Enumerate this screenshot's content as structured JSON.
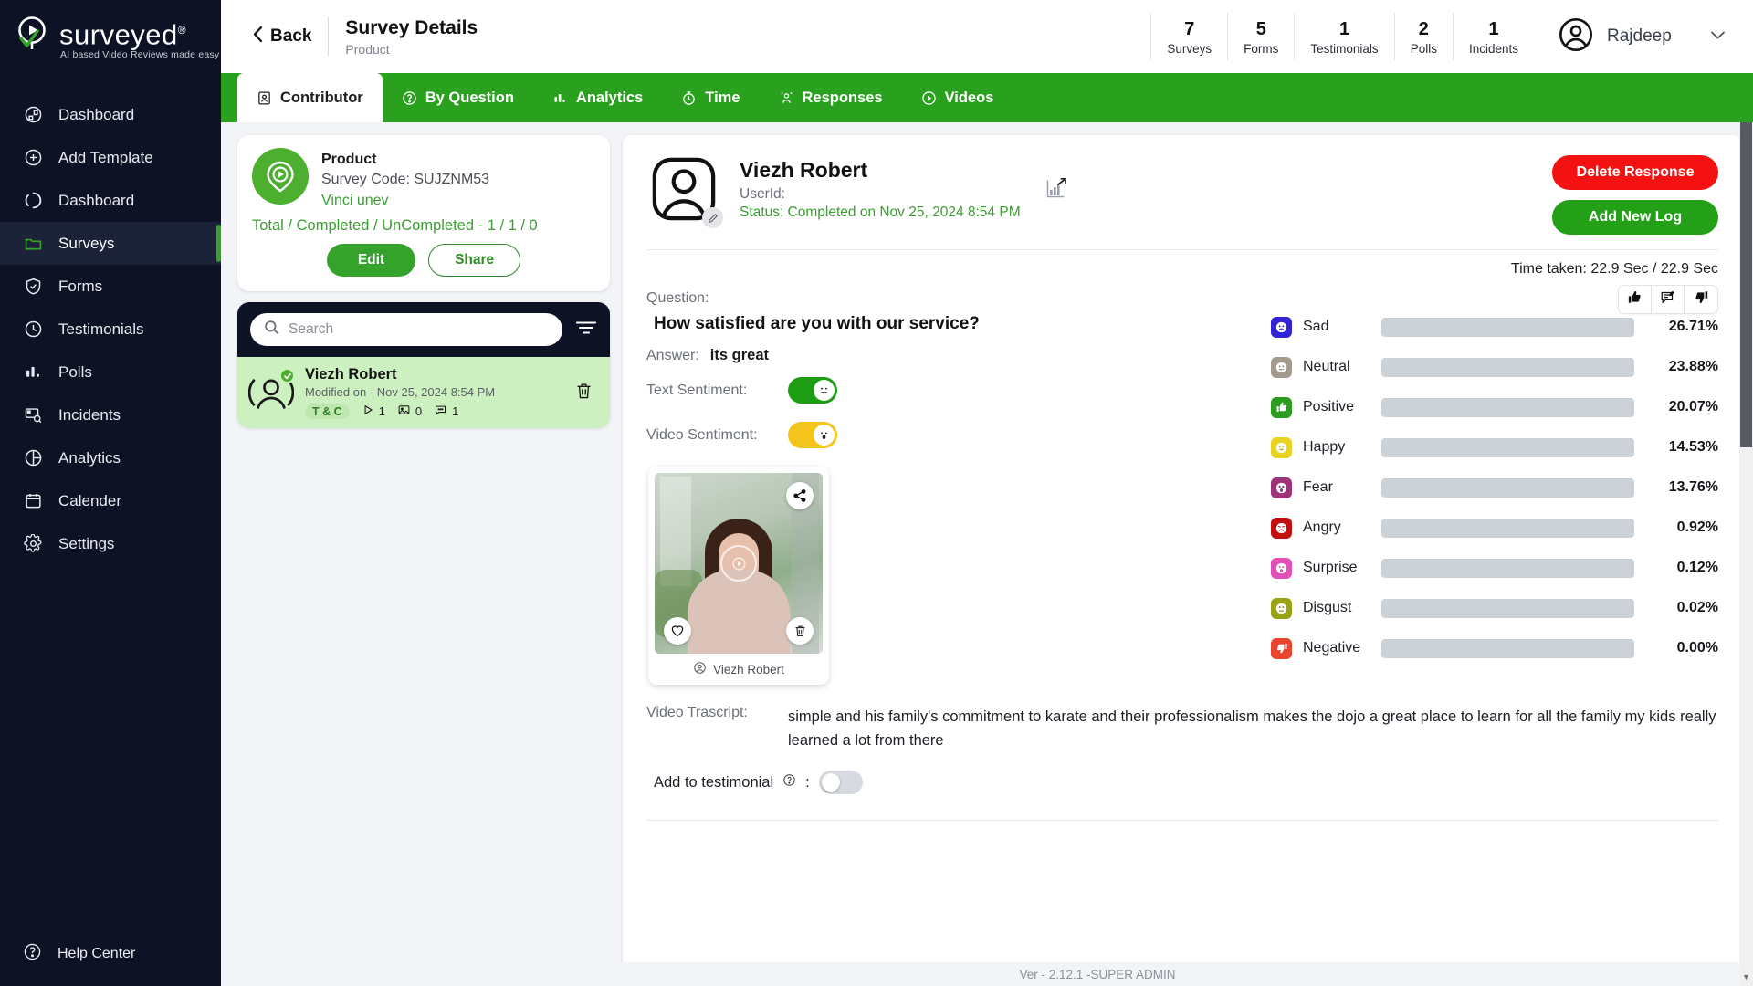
{
  "brand": {
    "name": "surveyed",
    "reg": "®",
    "tagline": "AI based Video Reviews made easy"
  },
  "sidebar": {
    "items": [
      {
        "label": "Dashboard",
        "icon": "dashboard-icon"
      },
      {
        "label": "Add Template",
        "icon": "plus-circle-icon"
      },
      {
        "label": "Dashboard",
        "icon": "loading-circle-icon"
      },
      {
        "label": "Surveys",
        "icon": "folder-icon"
      },
      {
        "label": "Forms",
        "icon": "shield-check-icon"
      },
      {
        "label": "Testimonials",
        "icon": "clock-icon"
      },
      {
        "label": "Polls",
        "icon": "bar-chart-icon"
      },
      {
        "label": "Incidents",
        "icon": "incident-search-icon"
      },
      {
        "label": "Analytics",
        "icon": "pie-chart-icon"
      },
      {
        "label": "Calender",
        "icon": "calendar-icon"
      },
      {
        "label": "Settings",
        "icon": "gear-icon"
      }
    ],
    "active_index": 3,
    "help": {
      "label": "Help Center",
      "icon": "question-circle-icon"
    }
  },
  "topbar": {
    "back_label": "Back",
    "title": "Survey Details",
    "subtitle": "Product",
    "stats": [
      {
        "value": "7",
        "label": "Surveys"
      },
      {
        "value": "5",
        "label": "Forms"
      },
      {
        "value": "1",
        "label": "Testimonials"
      },
      {
        "value": "2",
        "label": "Polls"
      },
      {
        "value": "1",
        "label": "Incidents"
      }
    ],
    "user_name": "Rajdeep"
  },
  "tabs": [
    {
      "label": "Contributor",
      "icon": "contributor-icon",
      "active": true
    },
    {
      "label": "By Question",
      "icon": "question-mark-icon",
      "active": false
    },
    {
      "label": "Analytics",
      "icon": "bar-chart-icon",
      "active": false
    },
    {
      "label": "Time",
      "icon": "stopwatch-icon",
      "active": false
    },
    {
      "label": "Responses",
      "icon": "responses-icon",
      "active": false
    },
    {
      "label": "Videos",
      "icon": "play-circle-icon",
      "active": false
    }
  ],
  "survey_card": {
    "name": "Product",
    "code": "Survey Code: SUJZNM53",
    "owner": "Vinci unev",
    "totals": "Total / Completed / UnCompleted - 1 / 1 / 0",
    "edit_label": "Edit",
    "share_label": "Share"
  },
  "search": {
    "placeholder": "Search",
    "value": ""
  },
  "respondent_list": [
    {
      "name": "Viezh Robert",
      "modified": "Modified on - Nov 25, 2024 8:54 PM",
      "tc": "T & C",
      "videos": "1",
      "images": "0",
      "comments": "1"
    }
  ],
  "detail": {
    "name": "Viezh Robert",
    "userid": "UserId:",
    "status": "Status: Completed on Nov 25, 2024 8:54 PM",
    "delete_label": "Delete Response",
    "add_log_label": "Add New Log",
    "time_taken": "Time taken: 22.9 Sec / 22.9 Sec",
    "question_label": "Question:",
    "question": "How satisfied are you with our service?",
    "answer_label": "Answer:",
    "answer": "its great",
    "text_sentiment_label": "Text Sentiment:",
    "text_sentiment_emoji": "😃",
    "video_sentiment_label": "Video Sentiment:",
    "video_sentiment_emoji": "😮",
    "video_caption": "Viezh Robert",
    "transcript_label": "Video Trascript:",
    "transcript": "simple and his family's commitment to karate and their professionalism makes the dojo a great place to learn for all the family my kids really learned a lot from there",
    "testimonial_label": "Add to testimonial",
    "testimonial_colon": ":"
  },
  "chart_data": {
    "type": "bar",
    "title": "Sentiment breakdown",
    "orientation": "horizontal",
    "xlim": [
      0,
      100
    ],
    "unit": "%",
    "categories": [
      "Sad",
      "Neutral",
      "Positive",
      "Happy",
      "Fear",
      "Angry",
      "Surprise",
      "Disgust",
      "Negative"
    ],
    "values": [
      26.71,
      23.88,
      20.07,
      14.53,
      13.76,
      0.92,
      0.12,
      0.02,
      0.0
    ],
    "labels": [
      "26.71%",
      "23.88%",
      "20.07%",
      "14.53%",
      "13.76%",
      "0.92%",
      "0.12%",
      "0.02%",
      "0.00%"
    ],
    "colors": [
      "#3224d4",
      "#a49a8d",
      "#2c9c1f",
      "#e8d321",
      "#9e3379",
      "#c40f0f",
      "#e051b8",
      "#9aa314",
      "#e8462f"
    ],
    "icon_colors": [
      "#3224d4",
      "#a49a8d",
      "#2c9c1f",
      "#e8d321",
      "#9e3379",
      "#c40f0f",
      "#e051b8",
      "#9aa314",
      "#e8462f"
    ],
    "icon_glyphs": [
      "☹",
      "☹",
      "👍",
      "☺",
      "😱",
      "😡",
      "😮",
      "😒",
      "👎"
    ],
    "track_color": "#ccd2d8",
    "bar_max_percent": 30
  },
  "footer": {
    "version": "Ver - 2.12.1 -SUPER ADMIN"
  },
  "colors": {
    "brand_green": "#29a11e",
    "danger_red": "#f31111",
    "sidebar_bg": "#0d1225"
  }
}
